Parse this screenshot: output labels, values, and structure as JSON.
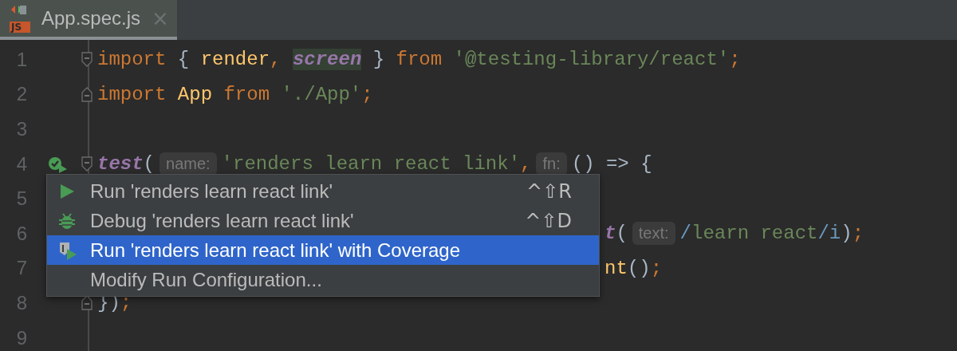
{
  "tabs": [
    {
      "icon_label": "JS",
      "label": "App.spec.js",
      "close": "×",
      "selected": true
    }
  ],
  "editor": {
    "lines": [
      {
        "number": "1",
        "fold_start": true,
        "segments": [
          {
            "kind": "keyword",
            "text": "import"
          },
          {
            "kind": "punct",
            "text": " { "
          },
          {
            "kind": "ident",
            "text": "render"
          },
          {
            "kind": "keyword",
            "text": ", "
          },
          {
            "kind": "field-hl",
            "text": "screen"
          },
          {
            "kind": "punct",
            "text": " } "
          },
          {
            "kind": "keyword",
            "text": "from "
          },
          {
            "kind": "string",
            "text": "'@testing-library/react'"
          },
          {
            "kind": "keyword",
            "text": ";"
          }
        ]
      },
      {
        "number": "2",
        "fold_end": true,
        "segments": [
          {
            "kind": "keyword",
            "text": "import "
          },
          {
            "kind": "ident",
            "text": "App "
          },
          {
            "kind": "keyword",
            "text": "from "
          },
          {
            "kind": "string",
            "text": "'./App'"
          },
          {
            "kind": "keyword",
            "text": ";"
          }
        ]
      },
      {
        "number": "3"
      },
      {
        "number": "4",
        "fold_start": true,
        "runnable": true,
        "segments": [
          {
            "kind": "call",
            "text": "test"
          },
          {
            "kind": "punct",
            "text": "("
          },
          {
            "kind": "hint",
            "text": "name:"
          },
          {
            "kind": "string",
            "text": "'renders learn react link'"
          },
          {
            "kind": "keyword",
            "text": ","
          },
          {
            "kind": "hint",
            "text": "fn:"
          },
          {
            "kind": "punct",
            "text": "() => {"
          }
        ]
      },
      {
        "number": "5"
      },
      {
        "number": "6",
        "kind": "covered",
        "segments": [
          {
            "kind": "call",
            "text": "t"
          },
          {
            "kind": "punct",
            "text": "("
          },
          {
            "kind": "hint",
            "text": "text:"
          },
          {
            "kind": "regex",
            "text": "/"
          },
          {
            "kind": "string",
            "text": "learn react"
          },
          {
            "kind": "regex",
            "text": "/i"
          },
          {
            "kind": "punct",
            "text": ")"
          },
          {
            "kind": "keyword",
            "text": ";"
          }
        ]
      },
      {
        "number": "7",
        "kind": "covered",
        "segments": [
          {
            "kind": "ident",
            "text": "nt"
          },
          {
            "kind": "punct",
            "text": "()"
          },
          {
            "kind": "keyword",
            "text": ";"
          }
        ]
      },
      {
        "number": "8",
        "fold_end": true,
        "segments": [
          {
            "kind": "punct",
            "text": "})"
          },
          {
            "kind": "keyword",
            "text": ";"
          }
        ]
      },
      {
        "number": "9"
      }
    ]
  },
  "popup_menu": {
    "items": [
      {
        "kind": "run",
        "label": "Run 'renders learn react link'",
        "shortcut": "^⇧R",
        "selected": false
      },
      {
        "kind": "debug",
        "label": "Debug 'renders learn react link'",
        "shortcut": "^⇧D",
        "selected": false
      },
      {
        "kind": "coverage",
        "label": "Run 'renders learn react link' with Coverage",
        "selected": true
      },
      {
        "kind": "edit",
        "label": "Modify Run Configuration...",
        "selected": false
      }
    ]
  }
}
